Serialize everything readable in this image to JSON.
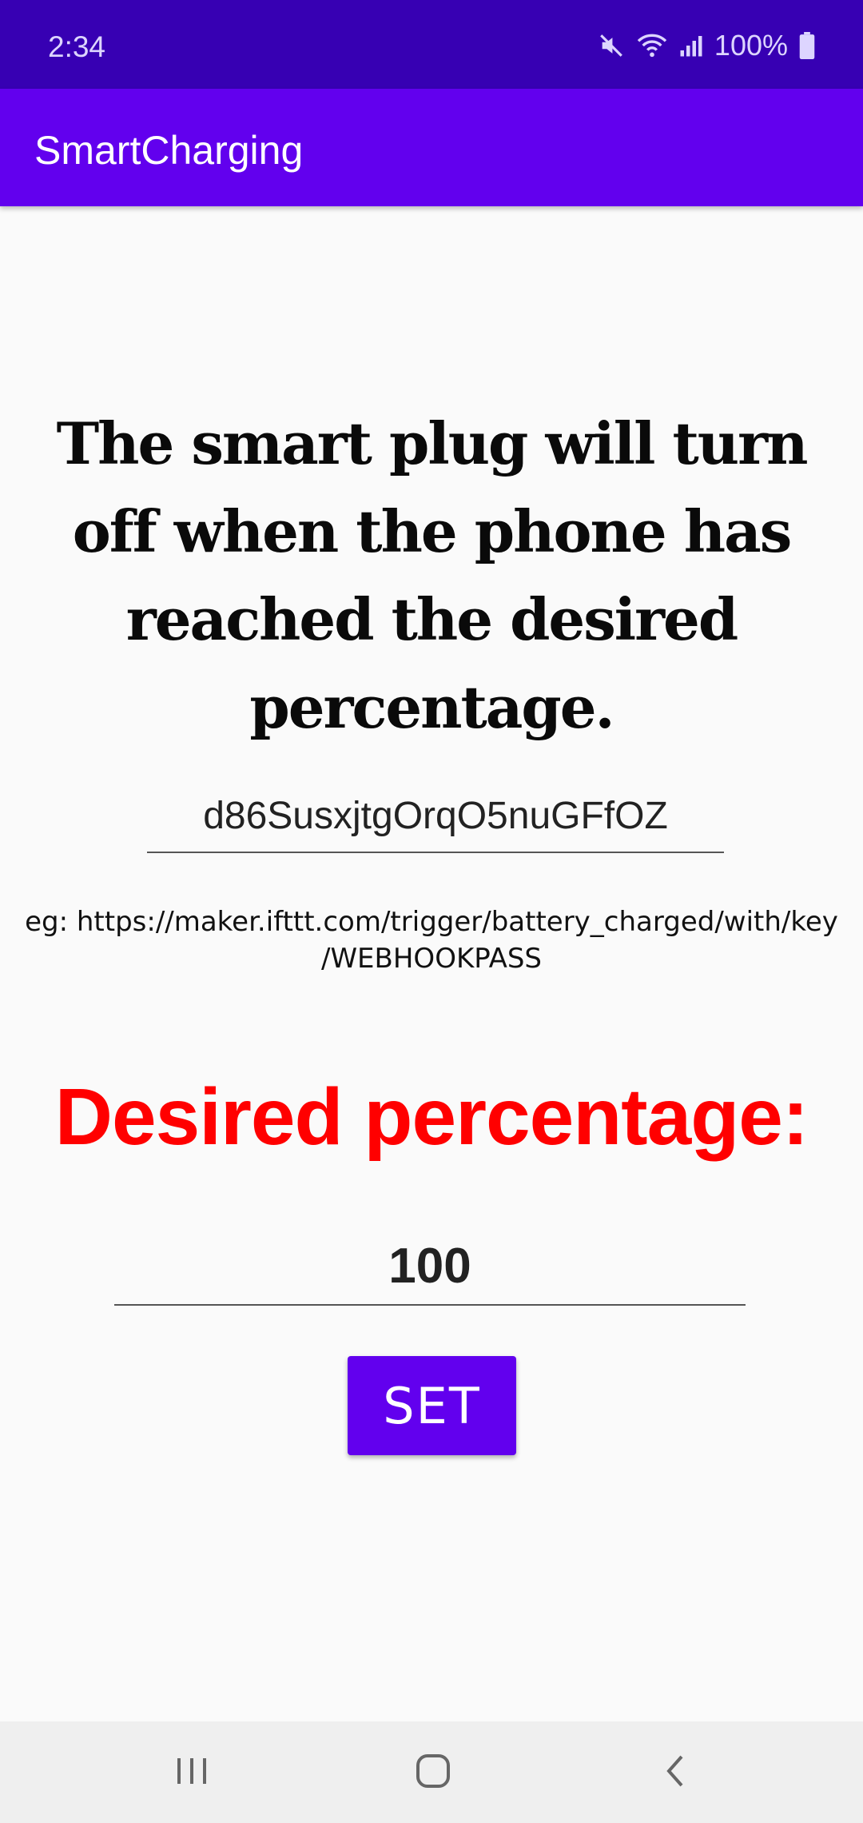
{
  "status_bar": {
    "time": "2:34",
    "battery": "100%",
    "icons": [
      "mute-icon",
      "wifi-icon",
      "signal-icon",
      "battery-icon"
    ]
  },
  "app_bar": {
    "title": "SmartCharging"
  },
  "main": {
    "headline": "The smart plug will turn off when the phone has reached the desired percentage.",
    "key_field": {
      "value": "d86SusxjtgOrqO5nuGFfOZ"
    },
    "hint_line1": "eg: https://maker.ifttt.com/trigger/battery_charged/with/key",
    "hint_line2": "/WEBHOOKPASS",
    "desired_label": "Desired percentage:",
    "percent_field": {
      "value": "100"
    },
    "set_button": "SET"
  },
  "nav_bar": {
    "icons": [
      "recents-icon",
      "home-icon",
      "back-icon"
    ]
  },
  "colors": {
    "status_bar": "#3700b3",
    "app_bar": "#6200ee",
    "accent": "#6200ee",
    "label_red": "#ff0000",
    "background": "#fafafa"
  }
}
